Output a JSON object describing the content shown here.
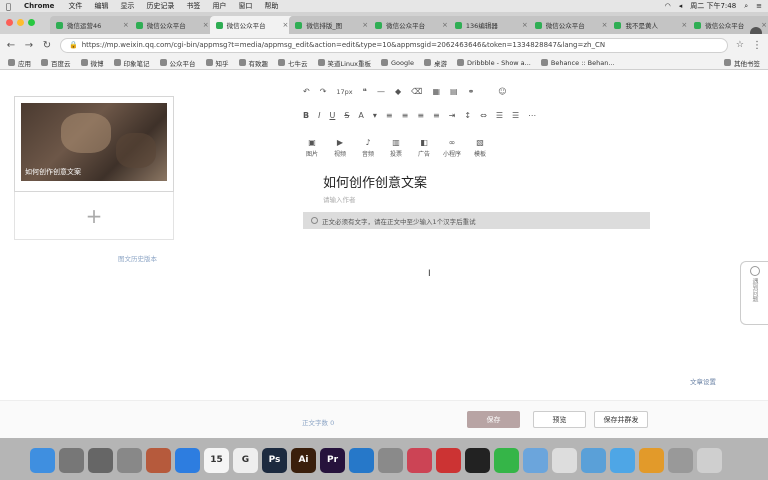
{
  "menubar": {
    "app": "Chrome",
    "items": [
      "文件",
      "编辑",
      "显示",
      "历史记录",
      "书签",
      "用户",
      "窗口",
      "帮助"
    ],
    "time": "周二 下午7:48"
  },
  "tabs": [
    {
      "label": "微信运营46",
      "active": false
    },
    {
      "label": "微信公众平台",
      "active": false
    },
    {
      "label": "微信公众平台",
      "active": true
    },
    {
      "label": "微信排版_图",
      "active": false
    },
    {
      "label": "微信公众平台",
      "active": false
    },
    {
      "label": "136编辑器",
      "active": false
    },
    {
      "label": "微信公众平台",
      "active": false
    },
    {
      "label": "我不是黄人",
      "active": false
    },
    {
      "label": "微信公众平台",
      "active": false
    }
  ],
  "address": {
    "url": "https://mp.weixin.qq.com/cgi-bin/appmsg?t=media/appmsg_edit&action=edit&type=10&appmsgid=2062463646&token=1334828847&lang=zh_CN"
  },
  "bookmarks": [
    "应用",
    "百度云",
    "微博",
    "印象笔记",
    "公众平台",
    "知乎",
    "有致趣",
    "七牛云",
    "笑道Linux重板",
    "Google",
    "桌游",
    "Dribbble - Show a...",
    "Behance :: Behan..."
  ],
  "bookmarks_other": "其他书签",
  "sidebar": {
    "thumb_caption": "如何创作创意文案",
    "add_icon": "+",
    "history_link": "图文历史版本"
  },
  "toolbar": {
    "font_size": "17px",
    "media": [
      {
        "icon": "image-icon",
        "label": "图片"
      },
      {
        "icon": "video-icon",
        "label": "视频"
      },
      {
        "icon": "audio-icon",
        "label": "音频"
      },
      {
        "icon": "vote-icon",
        "label": "投票"
      },
      {
        "icon": "ad-icon",
        "label": "广告"
      },
      {
        "icon": "miniprogram-icon",
        "label": "小程序"
      },
      {
        "icon": "template-icon",
        "label": "模板"
      }
    ]
  },
  "editor": {
    "title": "如何创作创意文案",
    "author_placeholder": "请输入作者",
    "notice": "正文必须有文字，请在正文中至少输入1个汉字后重试"
  },
  "feedback_label": "遇到问题",
  "settings_link": "文章设置",
  "bottombar": {
    "word_count": "正文字数 0",
    "save": "保存",
    "preview": "预览",
    "publish": "保存并群发"
  },
  "dock": {
    "icons": [
      {
        "name": "finder",
        "color": "#3f8fe0"
      },
      {
        "name": "launchpad",
        "color": "#777"
      },
      {
        "name": "rocket",
        "color": "#666"
      },
      {
        "name": "system-prefs",
        "color": "#888"
      },
      {
        "name": "photo",
        "color": "#b65a3c"
      },
      {
        "name": "app-store",
        "color": "#2d7de0"
      },
      {
        "name": "calendar",
        "color": "#f5f5f5",
        "text": "15"
      },
      {
        "name": "chrome-g",
        "color": "#eee",
        "text": "G"
      },
      {
        "name": "photoshop",
        "color": "#1c2a3f",
        "text": "Ps"
      },
      {
        "name": "illustrator",
        "color": "#3a1f0c",
        "text": "Ai"
      },
      {
        "name": "premiere",
        "color": "#26123c",
        "text": "Pr"
      },
      {
        "name": "keynote",
        "color": "#2678c9"
      },
      {
        "name": "finder-2",
        "color": "#8a8a8a"
      },
      {
        "name": "clock",
        "color": "#c45"
      },
      {
        "name": "parallels",
        "color": "#c33"
      },
      {
        "name": "qq",
        "color": "#222"
      },
      {
        "name": "wechat",
        "color": "#35b548"
      },
      {
        "name": "folder",
        "color": "#6ba5dc"
      },
      {
        "name": "file",
        "color": "#ddd"
      },
      {
        "name": "downloads",
        "color": "#5aa0d8"
      },
      {
        "name": "vpn",
        "color": "#4ea6e6"
      },
      {
        "name": "dashboard",
        "color": "#e29a2a"
      },
      {
        "name": "tools",
        "color": "#999"
      },
      {
        "name": "trash",
        "color": "#cfcfcf"
      }
    ]
  }
}
